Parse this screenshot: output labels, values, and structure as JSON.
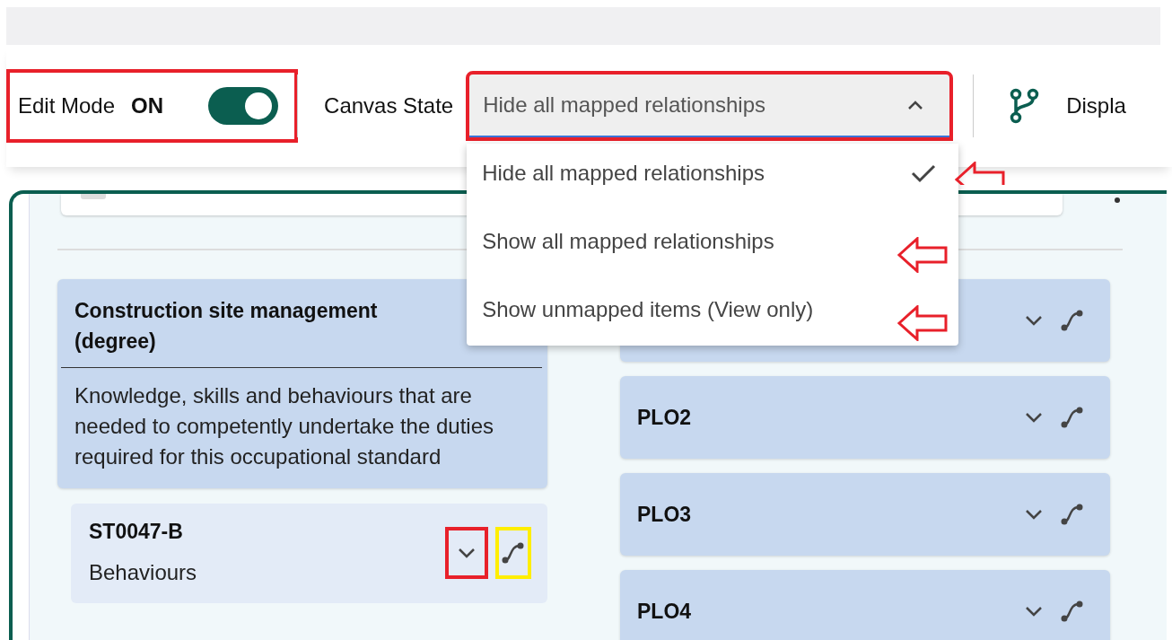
{
  "toolbar": {
    "edit_mode": {
      "label": "Edit Mode",
      "value": "ON",
      "on": true,
      "highlighted": true
    },
    "canvas_state": {
      "label": "Canvas State",
      "value": "Hide all mapped relationships",
      "expanded": true,
      "highlighted": true,
      "options": [
        {
          "label": "Hide all mapped relationships",
          "selected": true,
          "arrow": true
        },
        {
          "label": "Show all mapped relationships",
          "selected": false,
          "arrow": true
        },
        {
          "label": "Show unmapped items (View only)",
          "selected": false,
          "arrow": true
        }
      ]
    },
    "display": {
      "label": "Displa"
    }
  },
  "standard": {
    "title": "Construction site management (degree)",
    "description": "Knowledge, skills and behaviours that are needed to competently undertake the duties required for this occupational standard",
    "items": [
      {
        "code": "ST0047-B",
        "name": "Behaviours",
        "chevron_highlighted": true,
        "link_highlighted": true
      }
    ]
  },
  "outcomes": {
    "leading_card_under_menu": true,
    "items": [
      {
        "label": "PLO2"
      },
      {
        "label": "PLO3"
      },
      {
        "label": "PLO4"
      }
    ]
  }
}
